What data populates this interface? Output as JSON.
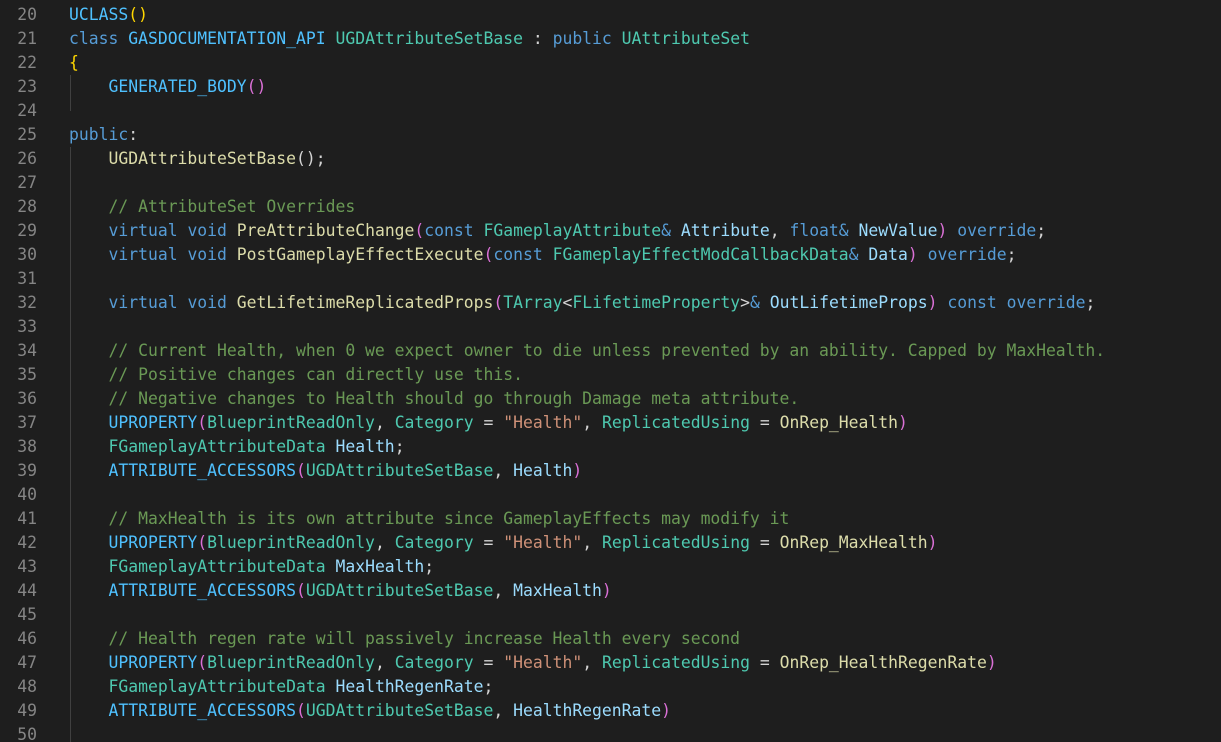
{
  "editor": {
    "lines": [
      {
        "number": "20",
        "tokens": [
          {
            "t": "UCLASS",
            "c": "mac"
          },
          {
            "t": "()",
            "c": "p1"
          }
        ]
      },
      {
        "number": "21",
        "tokens": [
          {
            "t": "class",
            "c": "kw"
          },
          {
            "t": " ",
            "c": "op"
          },
          {
            "t": "GASDOCUMENTATION_API",
            "c": "mac"
          },
          {
            "t": " ",
            "c": "op"
          },
          {
            "t": "UGDAttributeSetBase",
            "c": "type"
          },
          {
            "t": " : ",
            "c": "op"
          },
          {
            "t": "public",
            "c": "kw"
          },
          {
            "t": " ",
            "c": "op"
          },
          {
            "t": "UAttributeSet",
            "c": "type"
          }
        ]
      },
      {
        "number": "22",
        "tokens": [
          {
            "t": "{",
            "c": "p1"
          }
        ]
      },
      {
        "number": "23",
        "tokens": [
          {
            "t": "    ",
            "c": "op"
          },
          {
            "t": "GENERATED_BODY",
            "c": "mac"
          },
          {
            "t": "()",
            "c": "p2"
          }
        ]
      },
      {
        "number": "24",
        "tokens": []
      },
      {
        "number": "25",
        "tokens": [
          {
            "t": "public",
            "c": "kw"
          },
          {
            "t": ":",
            "c": "op"
          }
        ]
      },
      {
        "number": "26",
        "tokens": [
          {
            "t": "    ",
            "c": "op"
          },
          {
            "t": "UGDAttributeSetBase",
            "c": "fn"
          },
          {
            "t": "();",
            "c": "op"
          }
        ]
      },
      {
        "number": "27",
        "tokens": []
      },
      {
        "number": "28",
        "tokens": [
          {
            "t": "    ",
            "c": "op"
          },
          {
            "t": "// AttributeSet Overrides",
            "c": "com"
          }
        ]
      },
      {
        "number": "29",
        "tokens": [
          {
            "t": "    ",
            "c": "op"
          },
          {
            "t": "virtual",
            "c": "kw"
          },
          {
            "t": " ",
            "c": "op"
          },
          {
            "t": "void",
            "c": "kw"
          },
          {
            "t": " ",
            "c": "op"
          },
          {
            "t": "PreAttributeChange",
            "c": "fn"
          },
          {
            "t": "(",
            "c": "p2"
          },
          {
            "t": "const",
            "c": "kw"
          },
          {
            "t": " ",
            "c": "op"
          },
          {
            "t": "FGameplayAttribute",
            "c": "type"
          },
          {
            "t": "& ",
            "c": "kw"
          },
          {
            "t": "Attribute",
            "c": "var"
          },
          {
            "t": ", ",
            "c": "op"
          },
          {
            "t": "float",
            "c": "kw"
          },
          {
            "t": "& ",
            "c": "kw"
          },
          {
            "t": "NewValue",
            "c": "var"
          },
          {
            "t": ")",
            "c": "p2"
          },
          {
            "t": " ",
            "c": "op"
          },
          {
            "t": "override",
            "c": "kw"
          },
          {
            "t": ";",
            "c": "op"
          }
        ]
      },
      {
        "number": "30",
        "tokens": [
          {
            "t": "    ",
            "c": "op"
          },
          {
            "t": "virtual",
            "c": "kw"
          },
          {
            "t": " ",
            "c": "op"
          },
          {
            "t": "void",
            "c": "kw"
          },
          {
            "t": " ",
            "c": "op"
          },
          {
            "t": "PostGameplayEffectExecute",
            "c": "fn"
          },
          {
            "t": "(",
            "c": "p2"
          },
          {
            "t": "const",
            "c": "kw"
          },
          {
            "t": " ",
            "c": "op"
          },
          {
            "t": "FGameplayEffectModCallbackData",
            "c": "type"
          },
          {
            "t": "& ",
            "c": "kw"
          },
          {
            "t": "Data",
            "c": "var"
          },
          {
            "t": ")",
            "c": "p2"
          },
          {
            "t": " ",
            "c": "op"
          },
          {
            "t": "override",
            "c": "kw"
          },
          {
            "t": ";",
            "c": "op"
          }
        ]
      },
      {
        "number": "31",
        "tokens": []
      },
      {
        "number": "32",
        "tokens": [
          {
            "t": "    ",
            "c": "op"
          },
          {
            "t": "virtual",
            "c": "kw"
          },
          {
            "t": " ",
            "c": "op"
          },
          {
            "t": "void",
            "c": "kw"
          },
          {
            "t": " ",
            "c": "op"
          },
          {
            "t": "GetLifetimeReplicatedProps",
            "c": "fn"
          },
          {
            "t": "(",
            "c": "p2"
          },
          {
            "t": "TArray",
            "c": "type"
          },
          {
            "t": "<",
            "c": "op"
          },
          {
            "t": "FLifetimeProperty",
            "c": "type"
          },
          {
            "t": ">",
            "c": "op"
          },
          {
            "t": "& ",
            "c": "kw"
          },
          {
            "t": "OutLifetimeProps",
            "c": "var"
          },
          {
            "t": ")",
            "c": "p2"
          },
          {
            "t": " ",
            "c": "op"
          },
          {
            "t": "const",
            "c": "kw"
          },
          {
            "t": " ",
            "c": "op"
          },
          {
            "t": "override",
            "c": "kw"
          },
          {
            "t": ";",
            "c": "op"
          }
        ]
      },
      {
        "number": "33",
        "tokens": []
      },
      {
        "number": "34",
        "tokens": [
          {
            "t": "    ",
            "c": "op"
          },
          {
            "t": "// Current Health, when 0 we expect owner to die unless prevented by an ability. Capped by MaxHealth.",
            "c": "com"
          }
        ]
      },
      {
        "number": "35",
        "tokens": [
          {
            "t": "    ",
            "c": "op"
          },
          {
            "t": "// Positive changes can directly use this.",
            "c": "com"
          }
        ]
      },
      {
        "number": "36",
        "tokens": [
          {
            "t": "    ",
            "c": "op"
          },
          {
            "t": "// Negative changes to Health should go through Damage meta attribute.",
            "c": "com"
          }
        ]
      },
      {
        "number": "37",
        "tokens": [
          {
            "t": "    ",
            "c": "op"
          },
          {
            "t": "UPROPERTY",
            "c": "mac"
          },
          {
            "t": "(",
            "c": "p2"
          },
          {
            "t": "BlueprintReadOnly",
            "c": "type"
          },
          {
            "t": ", ",
            "c": "op"
          },
          {
            "t": "Category",
            "c": "type"
          },
          {
            "t": " = ",
            "c": "op"
          },
          {
            "t": "\"Health\"",
            "c": "str"
          },
          {
            "t": ", ",
            "c": "op"
          },
          {
            "t": "ReplicatedUsing",
            "c": "type"
          },
          {
            "t": " = ",
            "c": "op"
          },
          {
            "t": "OnRep_Health",
            "c": "fn"
          },
          {
            "t": ")",
            "c": "p2"
          }
        ]
      },
      {
        "number": "38",
        "tokens": [
          {
            "t": "    ",
            "c": "op"
          },
          {
            "t": "FGameplayAttributeData",
            "c": "type"
          },
          {
            "t": " ",
            "c": "op"
          },
          {
            "t": "Health",
            "c": "var"
          },
          {
            "t": ";",
            "c": "op"
          }
        ]
      },
      {
        "number": "39",
        "tokens": [
          {
            "t": "    ",
            "c": "op"
          },
          {
            "t": "ATTRIBUTE_ACCESSORS",
            "c": "mac"
          },
          {
            "t": "(",
            "c": "p2"
          },
          {
            "t": "UGDAttributeSetBase",
            "c": "type"
          },
          {
            "t": ", ",
            "c": "op"
          },
          {
            "t": "Health",
            "c": "var"
          },
          {
            "t": ")",
            "c": "p2"
          }
        ]
      },
      {
        "number": "40",
        "tokens": []
      },
      {
        "number": "41",
        "tokens": [
          {
            "t": "    ",
            "c": "op"
          },
          {
            "t": "// MaxHealth is its own attribute since GameplayEffects may modify it",
            "c": "com"
          }
        ]
      },
      {
        "number": "42",
        "tokens": [
          {
            "t": "    ",
            "c": "op"
          },
          {
            "t": "UPROPERTY",
            "c": "mac"
          },
          {
            "t": "(",
            "c": "p2"
          },
          {
            "t": "BlueprintReadOnly",
            "c": "type"
          },
          {
            "t": ", ",
            "c": "op"
          },
          {
            "t": "Category",
            "c": "type"
          },
          {
            "t": " = ",
            "c": "op"
          },
          {
            "t": "\"Health\"",
            "c": "str"
          },
          {
            "t": ", ",
            "c": "op"
          },
          {
            "t": "ReplicatedUsing",
            "c": "type"
          },
          {
            "t": " = ",
            "c": "op"
          },
          {
            "t": "OnRep_MaxHealth",
            "c": "fn"
          },
          {
            "t": ")",
            "c": "p2"
          }
        ]
      },
      {
        "number": "43",
        "tokens": [
          {
            "t": "    ",
            "c": "op"
          },
          {
            "t": "FGameplayAttributeData",
            "c": "type"
          },
          {
            "t": " ",
            "c": "op"
          },
          {
            "t": "MaxHealth",
            "c": "var"
          },
          {
            "t": ";",
            "c": "op"
          }
        ]
      },
      {
        "number": "44",
        "tokens": [
          {
            "t": "    ",
            "c": "op"
          },
          {
            "t": "ATTRIBUTE_ACCESSORS",
            "c": "mac"
          },
          {
            "t": "(",
            "c": "p2"
          },
          {
            "t": "UGDAttributeSetBase",
            "c": "type"
          },
          {
            "t": ", ",
            "c": "op"
          },
          {
            "t": "MaxHealth",
            "c": "var"
          },
          {
            "t": ")",
            "c": "p2"
          }
        ]
      },
      {
        "number": "45",
        "tokens": []
      },
      {
        "number": "46",
        "tokens": [
          {
            "t": "    ",
            "c": "op"
          },
          {
            "t": "// Health regen rate will passively increase Health every second",
            "c": "com"
          }
        ]
      },
      {
        "number": "47",
        "tokens": [
          {
            "t": "    ",
            "c": "op"
          },
          {
            "t": "UPROPERTY",
            "c": "mac"
          },
          {
            "t": "(",
            "c": "p2"
          },
          {
            "t": "BlueprintReadOnly",
            "c": "type"
          },
          {
            "t": ", ",
            "c": "op"
          },
          {
            "t": "Category",
            "c": "type"
          },
          {
            "t": " = ",
            "c": "op"
          },
          {
            "t": "\"Health\"",
            "c": "str"
          },
          {
            "t": ", ",
            "c": "op"
          },
          {
            "t": "ReplicatedUsing",
            "c": "type"
          },
          {
            "t": " = ",
            "c": "op"
          },
          {
            "t": "OnRep_HealthRegenRate",
            "c": "fn"
          },
          {
            "t": ")",
            "c": "p2"
          }
        ]
      },
      {
        "number": "48",
        "tokens": [
          {
            "t": "    ",
            "c": "op"
          },
          {
            "t": "FGameplayAttributeData",
            "c": "type"
          },
          {
            "t": " ",
            "c": "op"
          },
          {
            "t": "HealthRegenRate",
            "c": "var"
          },
          {
            "t": ";",
            "c": "op"
          }
        ]
      },
      {
        "number": "49",
        "tokens": [
          {
            "t": "    ",
            "c": "op"
          },
          {
            "t": "ATTRIBUTE_ACCESSORS",
            "c": "mac"
          },
          {
            "t": "(",
            "c": "p2"
          },
          {
            "t": "UGDAttributeSetBase",
            "c": "type"
          },
          {
            "t": ", ",
            "c": "op"
          },
          {
            "t": "HealthRegenRate",
            "c": "var"
          },
          {
            "t": ")",
            "c": "p2"
          }
        ]
      },
      {
        "number": "50",
        "tokens": []
      }
    ]
  }
}
